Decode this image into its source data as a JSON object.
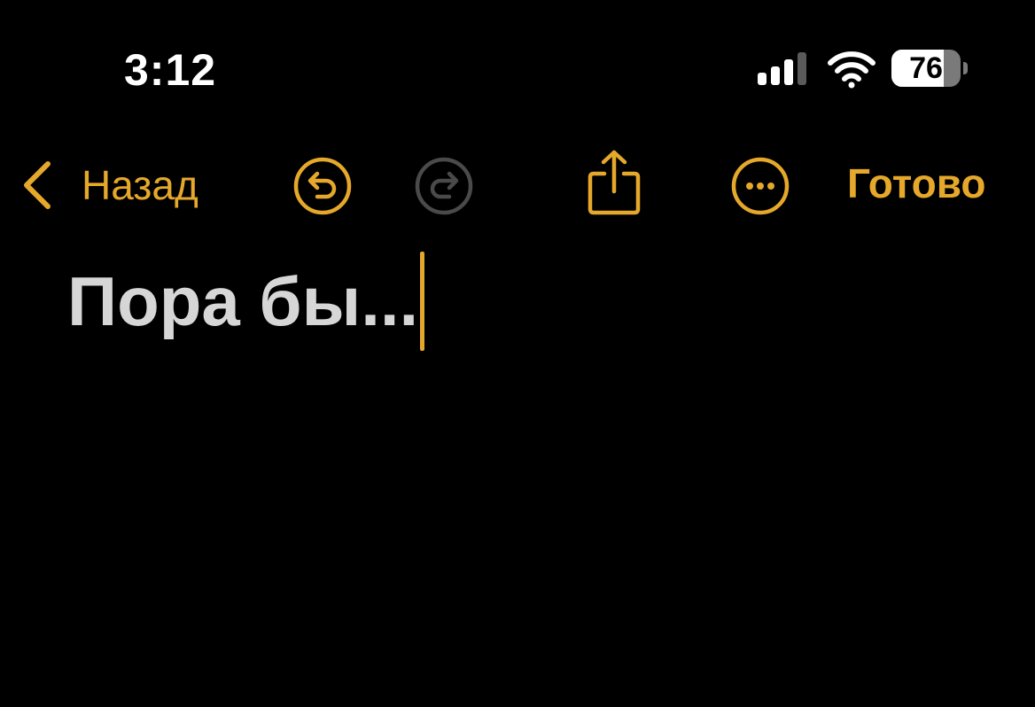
{
  "status_bar": {
    "time": "3:12",
    "battery_level": "76",
    "battery_fraction": 0.76,
    "icons": [
      "cellular-signal-icon",
      "wifi-icon",
      "battery-icon"
    ]
  },
  "toolbar": {
    "back_label": "Назад",
    "done_label": "Готово",
    "icons": [
      "chevron-left-icon",
      "undo-icon",
      "redo-icon",
      "share-icon",
      "more-icon"
    ],
    "redo_enabled": false
  },
  "note": {
    "title": "Пора бы..."
  },
  "colors": {
    "accent": "#e5a82a",
    "background": "#000000",
    "title_text": "#d6d6d6",
    "disabled_icon": "#4a4a4a"
  }
}
